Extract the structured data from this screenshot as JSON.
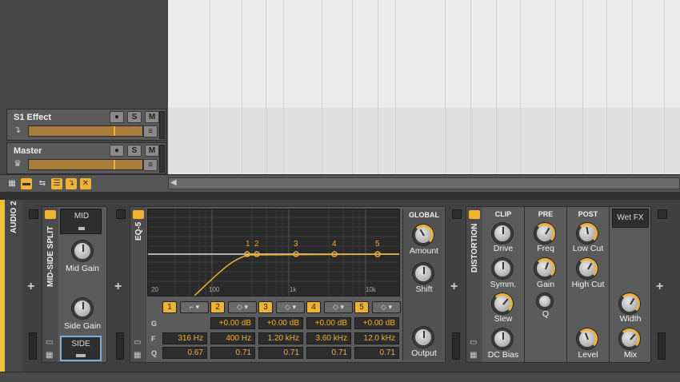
{
  "tracks": [
    {
      "name": "S1 Effect",
      "icon": "return-arrow-icon",
      "solo": "S",
      "mute": "M"
    },
    {
      "name": "Master",
      "icon": "crown-icon",
      "solo": "S",
      "mute": "M"
    }
  ],
  "panel": {
    "track_label": "AUDIO 2"
  },
  "midside": {
    "title": "MID-SIDE SPLIT",
    "mid_label": "MID",
    "side_label": "SIDE",
    "mid_gain_label": "Mid Gain",
    "side_gain_label": "Side Gain"
  },
  "eq": {
    "title": "EQ-5",
    "freq_ticks": [
      "20",
      "100",
      "1k",
      "10k"
    ],
    "markers": [
      "1",
      "2",
      "3",
      "4",
      "5"
    ],
    "row_labels": {
      "g": "G",
      "f": "F",
      "q": "Q"
    },
    "bands": [
      {
        "num": "1",
        "gain": "",
        "freq": "316 Hz",
        "q": "0.67"
      },
      {
        "num": "2",
        "gain": "+0.00 dB",
        "freq": "400 Hz",
        "q": "0.71"
      },
      {
        "num": "3",
        "gain": "+0.00 dB",
        "freq": "1.20 kHz",
        "q": "0.71"
      },
      {
        "num": "4",
        "gain": "+0.00 dB",
        "freq": "3.60 kHz",
        "q": "0.71"
      },
      {
        "num": "5",
        "gain": "+0.00 dB",
        "freq": "12.0 kHz",
        "q": "0.71"
      }
    ],
    "global": {
      "title": "GLOBAL",
      "amount": "Amount",
      "shift": "Shift",
      "output": "Output"
    }
  },
  "distortion": {
    "title": "DISTORTION",
    "clip": {
      "title": "CLIP",
      "drive": "Drive",
      "symm": "Symm.",
      "slew": "Slew",
      "dc": "DC Bias"
    },
    "pre": {
      "title": "PRE",
      "freq": "Freq",
      "gain": "Gain",
      "q": "Q"
    },
    "post": {
      "title": "POST",
      "low_cut": "Low Cut",
      "high_cut": "High Cut",
      "level": "Level"
    },
    "wet": {
      "title": "Wet FX",
      "width": "Width",
      "mix": "Mix"
    }
  },
  "colors": {
    "accent": "#f0b030",
    "panel": "#404040"
  }
}
